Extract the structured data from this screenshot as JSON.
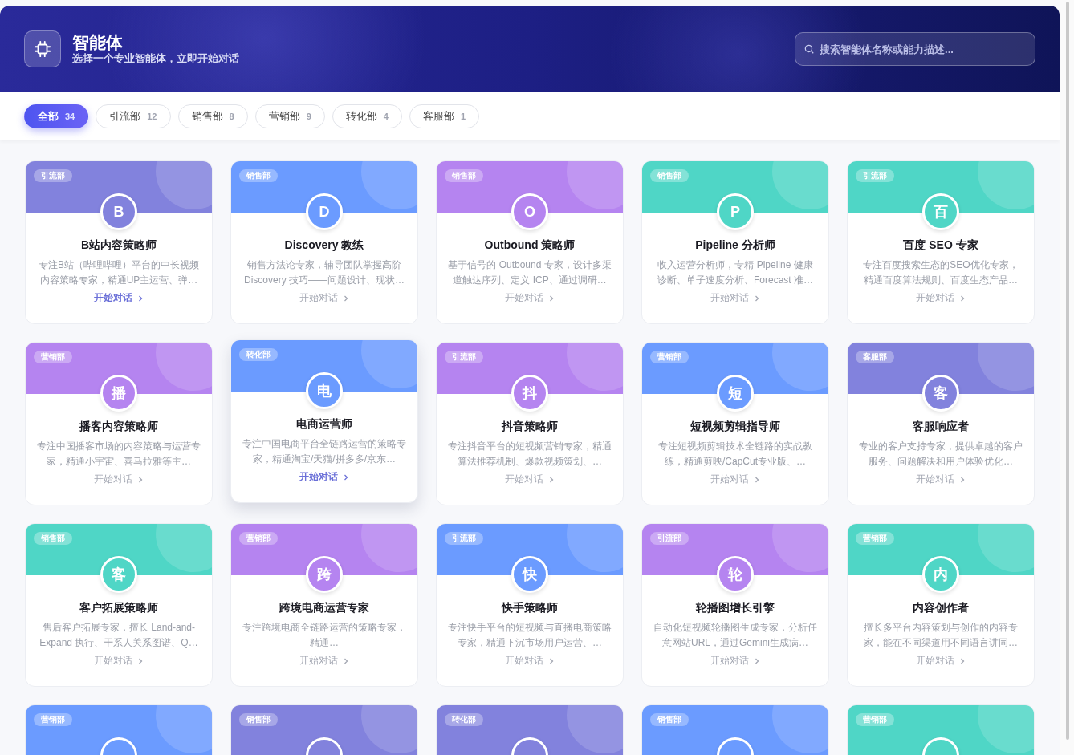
{
  "header": {
    "title": "智能体",
    "subtitle": "选择一个专业智能体，立即开始对话"
  },
  "search": {
    "placeholder": "搜索智能体名称或能力描述..."
  },
  "tabs": [
    {
      "label": "全部",
      "count": "34",
      "selected": true
    },
    {
      "label": "引流部",
      "count": "12",
      "selected": false
    },
    {
      "label": "销售部",
      "count": "8",
      "selected": false
    },
    {
      "label": "营销部",
      "count": "9",
      "selected": false
    },
    {
      "label": "转化部",
      "count": "4",
      "selected": false
    },
    {
      "label": "客服部",
      "count": "1",
      "selected": false
    }
  ],
  "agents": [
    {
      "department": "引流部",
      "avatar": "B",
      "color": "#8282dd",
      "name": "B站内容策略师",
      "description": "专注B站（哔哩哔哩）平台的中长视频内容策略专家，精通UP主运营、弹…",
      "action": "开始对话",
      "hovered": false,
      "link_highlighted": true
    },
    {
      "department": "销售部",
      "avatar": "D",
      "color": "#6b9bff",
      "name": "Discovery 教练",
      "description": "销售方法论专家，辅导团队掌握高阶Discovery 技巧——问题设计、现状…",
      "action": "开始对话",
      "hovered": false,
      "link_highlighted": false
    },
    {
      "department": "销售部",
      "avatar": "O",
      "color": "#b584f0",
      "name": "Outbound 策略师",
      "description": "基于信号的 Outbound 专家，设计多渠道触达序列、定义 ICP、通过调研…",
      "action": "开始对话",
      "hovered": false,
      "link_highlighted": false
    },
    {
      "department": "销售部",
      "avatar": "P",
      "color": "#4fd6c6",
      "name": "Pipeline 分析师",
      "description": "收入运营分析师，专精 Pipeline 健康诊断、单子速度分析、Forecast 准…",
      "action": "开始对话",
      "hovered": false,
      "link_highlighted": false
    },
    {
      "department": "引流部",
      "avatar": "百",
      "color": "#4fd6c6",
      "name": "百度 SEO 专家",
      "description": "专注百度搜索生态的SEO优化专家，精通百度算法规则、百度生态产品…",
      "action": "开始对话",
      "hovered": false,
      "link_highlighted": false
    },
    {
      "department": "营销部",
      "avatar": "播",
      "color": "#b584f0",
      "name": "播客内容策略师",
      "description": "专注中国播客市场的内容策略与运营专家，精通小宇宙、喜马拉雅等主…",
      "action": "开始对话",
      "hovered": false,
      "link_highlighted": false
    },
    {
      "department": "转化部",
      "avatar": "电",
      "color": "#6b9bff",
      "name": "电商运营师",
      "description": "专注中国电商平台全链路运营的策略专家，精通淘宝/天猫/拼多多/京东…",
      "action": "开始对话",
      "hovered": true,
      "link_highlighted": true
    },
    {
      "department": "引流部",
      "avatar": "抖",
      "color": "#b584f0",
      "name": "抖音策略师",
      "description": "专注抖音平台的短视频营销专家，精通算法推荐机制、爆款视频策划、…",
      "action": "开始对话",
      "hovered": false,
      "link_highlighted": false
    },
    {
      "department": "营销部",
      "avatar": "短",
      "color": "#6b9bff",
      "name": "短视频剪辑指导师",
      "description": "专注短视频剪辑技术全链路的实战教练，精通剪映/CapCut专业版、…",
      "action": "开始对话",
      "hovered": false,
      "link_highlighted": false
    },
    {
      "department": "客服部",
      "avatar": "客",
      "color": "#8282dd",
      "name": "客服响应者",
      "description": "专业的客户支持专家，提供卓越的客户服务、问题解决和用户体验优化…",
      "action": "开始对话",
      "hovered": false,
      "link_highlighted": false
    },
    {
      "department": "销售部",
      "avatar": "客",
      "color": "#4fd6c6",
      "name": "客户拓展策略师",
      "description": "售后客户拓展专家，擅长 Land-and-Expand 执行、干系人关系图谱、Q…",
      "action": "开始对话",
      "hovered": false,
      "link_highlighted": false
    },
    {
      "department": "营销部",
      "avatar": "跨",
      "color": "#b584f0",
      "name": "跨境电商运营专家",
      "description": "专注跨境电商全链路运营的策略专家，精通…",
      "action": "开始对话",
      "hovered": false,
      "link_highlighted": false
    },
    {
      "department": "引流部",
      "avatar": "快",
      "color": "#6b9bff",
      "name": "快手策略师",
      "description": "专注快手平台的短视频与直播电商策略专家，精通下沉市场用户运营、…",
      "action": "开始对话",
      "hovered": false,
      "link_highlighted": false
    },
    {
      "department": "引流部",
      "avatar": "轮",
      "color": "#b584f0",
      "name": "轮播图增长引擎",
      "description": "自动化短视频轮播图生成专家，分析任意网站URL，通过Gemini生成病…",
      "action": "开始对话",
      "hovered": false,
      "link_highlighted": false
    },
    {
      "department": "营销部",
      "avatar": "内",
      "color": "#4fd6c6",
      "name": "内容创作者",
      "description": "擅长多平台内容策划与创作的内容专家，能在不同渠道用不同语言讲同…",
      "action": "开始对话",
      "hovered": false,
      "link_highlighted": false
    },
    {
      "department": "营销部",
      "color": "#6b9bff",
      "hovered": false
    },
    {
      "department": "销售部",
      "color": "#8282dd",
      "hovered": false
    },
    {
      "department": "转化部",
      "color": "#8282dd",
      "hovered": false
    },
    {
      "department": "销售部",
      "color": "#6b9bff",
      "hovered": false
    },
    {
      "department": "营销部",
      "color": "#4fd6c6",
      "hovered": false
    }
  ]
}
